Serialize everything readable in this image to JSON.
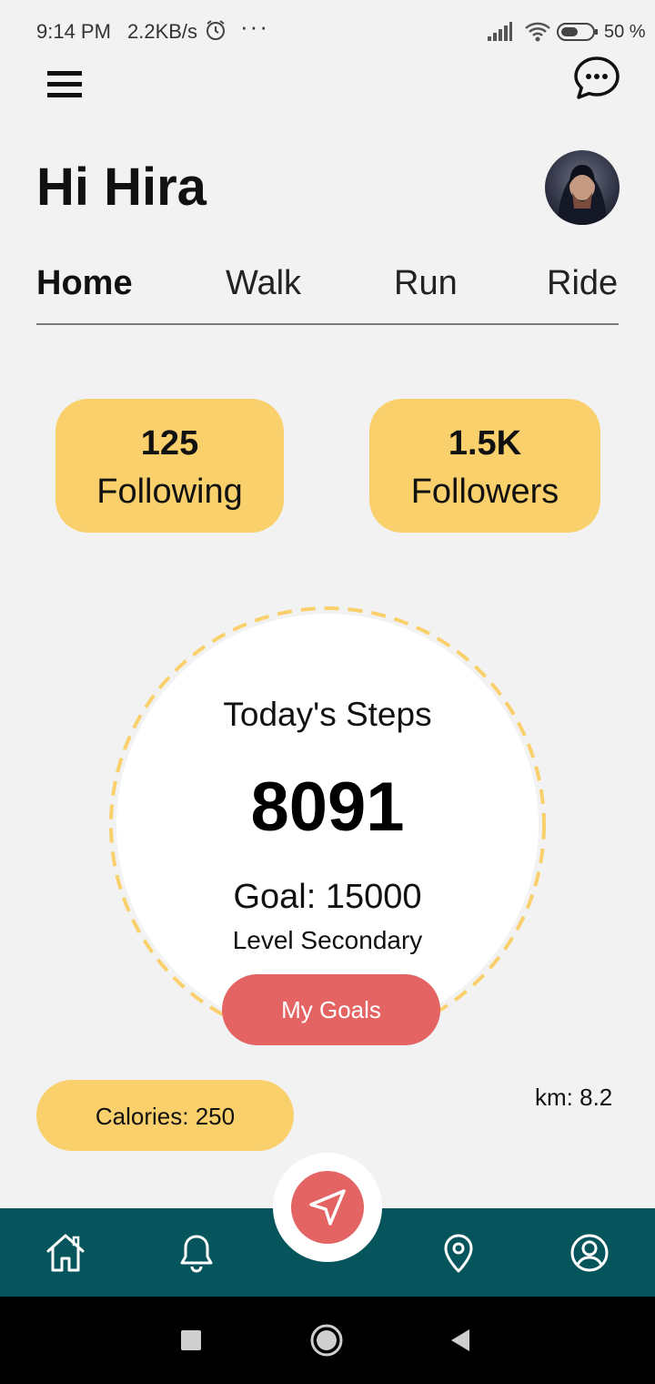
{
  "status_bar": {
    "time": "9:14 PM",
    "speed": "2.2KB/s",
    "more": "···",
    "battery_pct": "50 %",
    "icons": [
      "alarm-icon",
      "signal-icon",
      "wifi-icon",
      "battery-icon"
    ]
  },
  "header": {
    "greeting": "Hi Hira",
    "icons": [
      "menu-icon",
      "chat-icon"
    ]
  },
  "tabs": [
    {
      "label": "Home",
      "active": true
    },
    {
      "label": "Walk",
      "active": false
    },
    {
      "label": "Run",
      "active": false
    },
    {
      "label": "Ride",
      "active": false
    }
  ],
  "stats": {
    "following": {
      "value": "125",
      "label": "Following"
    },
    "followers": {
      "value": "1.5K",
      "label": "Followers"
    }
  },
  "steps": {
    "title": "Today's Steps",
    "value": "8091",
    "goal": "Goal: 15000",
    "level": "Level Secondary"
  },
  "goals_button": "My Goals",
  "calories": "Calories: 250",
  "km": "km: 8.2",
  "bottom_nav": [
    "home-icon",
    "bell-icon",
    "navigate-icon",
    "location-pin-icon",
    "profile-icon"
  ],
  "colors": {
    "accent_yellow": "#f9d06b",
    "accent_red": "#e46363",
    "nav_teal": "#07555c",
    "background": "#f2f2f2"
  }
}
